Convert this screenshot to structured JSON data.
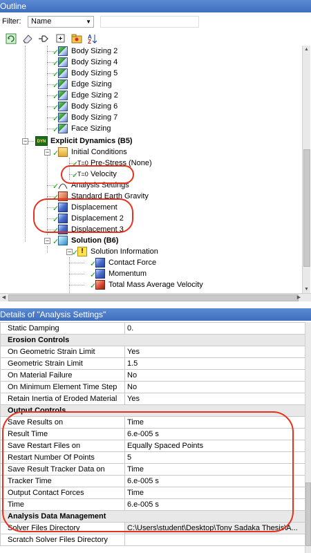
{
  "outline": {
    "title": "Outline",
    "filter_label": "Filter:",
    "filter_value": "Name",
    "tree": [
      {
        "label": "Body Sizing 2",
        "icon": "body-sizing-icon"
      },
      {
        "label": "Body Sizing 4",
        "icon": "body-sizing-icon"
      },
      {
        "label": "Body Sizing 5",
        "icon": "body-sizing-icon"
      },
      {
        "label": "Edge Sizing",
        "icon": "edge-sizing-icon"
      },
      {
        "label": "Edge Sizing 2",
        "icon": "edge-sizing-icon"
      },
      {
        "label": "Body Sizing 6",
        "icon": "body-sizing-icon"
      },
      {
        "label": "Body Sizing 7",
        "icon": "body-sizing-icon"
      },
      {
        "label": "Face Sizing",
        "icon": "face-sizing-icon"
      },
      {
        "label": "Explicit Dynamics (B5)",
        "icon": "dyn-icon"
      },
      {
        "label": "Initial Conditions",
        "icon": "initial-conditions-icon"
      },
      {
        "label": "Pre-Stress (None)",
        "icon": "prestress-icon"
      },
      {
        "label": "Velocity",
        "icon": "velocity-icon"
      },
      {
        "label": "Analysis Settings",
        "icon": "analysis-settings-icon"
      },
      {
        "label": "Standard Earth Gravity",
        "icon": "gravity-icon"
      },
      {
        "label": "Displacement",
        "icon": "displacement-icon"
      },
      {
        "label": "Displacement 2",
        "icon": "displacement-icon"
      },
      {
        "label": "Displacement 3",
        "icon": "displacement-icon"
      },
      {
        "label": "Solution (B6)",
        "icon": "solution-icon"
      },
      {
        "label": "Solution Information",
        "icon": "solution-information-icon"
      },
      {
        "label": "Contact Force",
        "icon": "probe-icon"
      },
      {
        "label": "Momentum",
        "icon": "probe-icon"
      },
      {
        "label": "Total Mass Average Velocity",
        "icon": "probe-icon"
      }
    ]
  },
  "details": {
    "title": "Details of \"Analysis Settings\"",
    "rows": [
      {
        "type": "row",
        "label": "Static Damping",
        "value": "0."
      },
      {
        "type": "section",
        "label": "Erosion Controls"
      },
      {
        "type": "row",
        "label": "On Geometric Strain Limit",
        "value": "Yes"
      },
      {
        "type": "row",
        "label": "Geometric Strain Limit",
        "value": "1.5"
      },
      {
        "type": "row",
        "label": "On Material Failure",
        "value": "No"
      },
      {
        "type": "row",
        "label": "On Minimum Element Time Step",
        "value": "No"
      },
      {
        "type": "row",
        "label": "Retain Inertia of Eroded Material",
        "value": "Yes"
      },
      {
        "type": "section",
        "label": "Output Controls"
      },
      {
        "type": "row",
        "label": "Save Results on",
        "value": "Time"
      },
      {
        "type": "row",
        "label": "Result Time",
        "value": "6.e-005 s"
      },
      {
        "type": "row",
        "label": "Save Restart Files on",
        "value": "Equally Spaced Points"
      },
      {
        "type": "row",
        "label": "Restart Number Of Points",
        "value": "5"
      },
      {
        "type": "row",
        "label": "Save Result Tracker Data on",
        "value": "Time"
      },
      {
        "type": "row",
        "label": "Tracker Time",
        "value": "6.e-005 s"
      },
      {
        "type": "row",
        "label": "Output Contact Forces",
        "value": "Time"
      },
      {
        "type": "row",
        "label": "Time",
        "value": "6.e-005 s"
      },
      {
        "type": "section",
        "label": "Analysis Data Management"
      },
      {
        "type": "row",
        "label": "Solver Files Directory",
        "value": "C:\\Users\\student\\Desktop\\Tony Sadaka Thesis\\A..."
      },
      {
        "type": "row",
        "label": "Scratch Solver Files Directory",
        "value": ""
      }
    ]
  },
  "colors": {
    "titlebar": "#4a7cc7",
    "annotation": "#e8311d",
    "check": "#1a9a1a"
  }
}
